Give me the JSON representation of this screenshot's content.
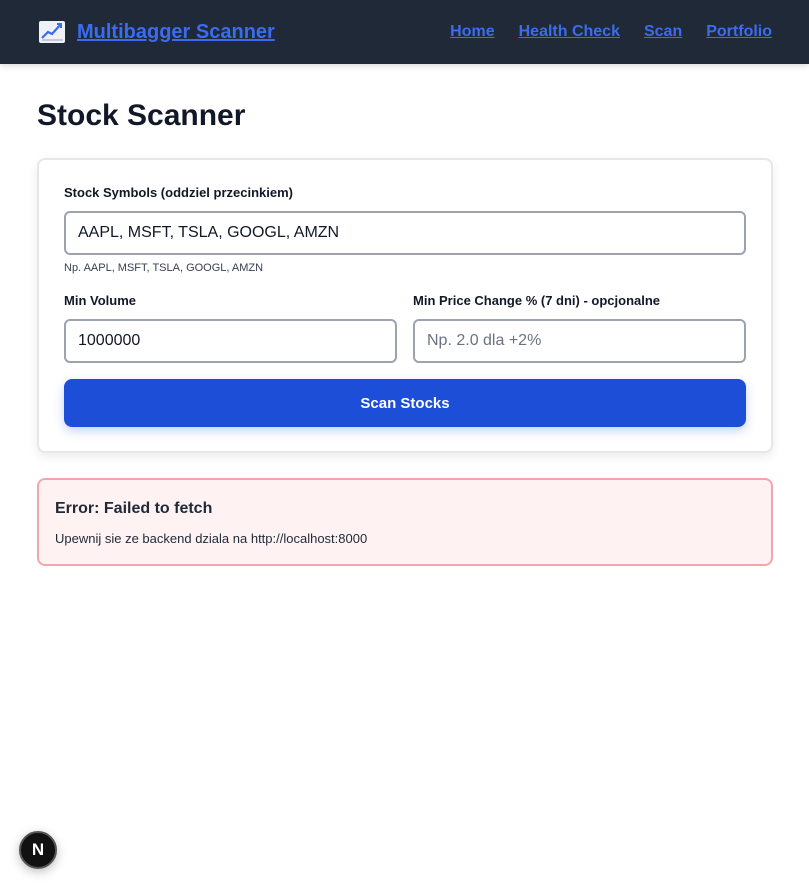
{
  "navbar": {
    "brand_label": "Multibagger Scanner",
    "brand_icon": "chart-increasing-icon",
    "links": [
      "Home",
      "Health Check",
      "Scan",
      "Portfolio"
    ]
  },
  "page": {
    "title": "Stock Scanner"
  },
  "form": {
    "symbols_label": "Stock Symbols (oddziel przecinkiem)",
    "symbols_value": "AAPL, MSFT, TSLA, GOOGL, AMZN",
    "symbols_hint": "Np. AAPL, MSFT, TSLA, GOOGL, AMZN",
    "min_volume_label": "Min Volume",
    "min_volume_value": "1000000",
    "min_price_change_label": "Min Price Change % (7 dni) - opcjonalne",
    "min_price_change_placeholder": "Np. 2.0 dla +2%",
    "min_price_change_value": "",
    "scan_button_label": "Scan Stocks"
  },
  "error": {
    "title": "Error: Failed to fetch",
    "message": "Upewnij sie ze backend dziala na http://localhost:8000"
  },
  "dev_badge": {
    "label": "N"
  },
  "colors": {
    "navbar_bg": "#1f2937",
    "link": "#3b6cf0",
    "button": "#1d4ed8",
    "error_bg": "#fef2f2",
    "error_border": "#f4a5ab"
  }
}
